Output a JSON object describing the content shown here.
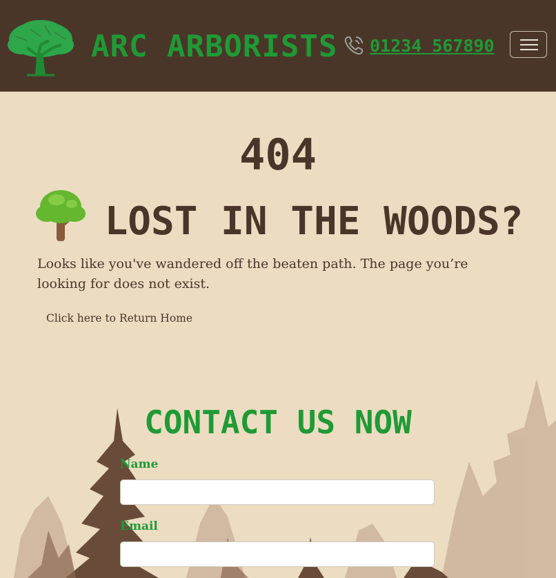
{
  "header": {
    "brand": "ARC ARBORISTS",
    "phone": "01234 567890",
    "icons": {
      "logo": "tree-logo-icon",
      "phone": "phone-icon",
      "menu": "hamburger-menu-icon"
    }
  },
  "error": {
    "code": "404",
    "headline": "Lost in the woods?",
    "headline_icon": "tree-emoji",
    "message": "Looks like you've wandered off the beaten path. The page you’re looking for does not exist.",
    "home_link": "Click here to Return Home"
  },
  "contact": {
    "title": "CONTACT US NOW",
    "name_label": "Name",
    "name_value": "",
    "email_label": "Email",
    "email_value": ""
  },
  "colors": {
    "header_bg": "#4a3629",
    "page_bg": "#ecdcc2",
    "accent_green": "#1f9a35",
    "text_brown": "#4a3629"
  }
}
